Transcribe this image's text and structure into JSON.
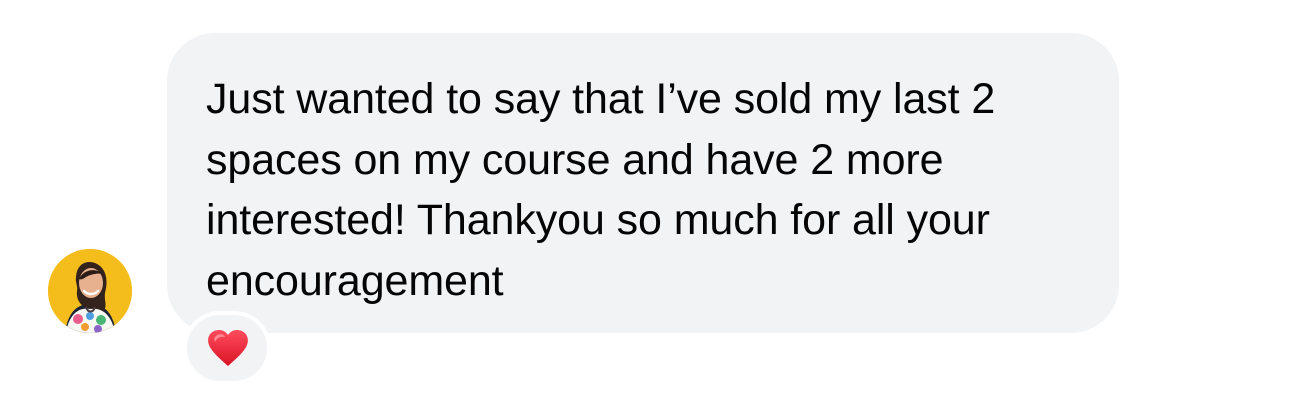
{
  "message": {
    "text": "Just wanted to say that I’ve sold my last 2 spaces on my course and have 2 more interested! Thankyou so much for all your encouragement"
  },
  "reaction": {
    "icon": "heart-icon"
  },
  "avatar": {
    "icon": "avatar"
  },
  "colors": {
    "bubble_background": "#f2f3f5",
    "avatar_background": "#f4bd1c",
    "heart": "#e0212f"
  }
}
